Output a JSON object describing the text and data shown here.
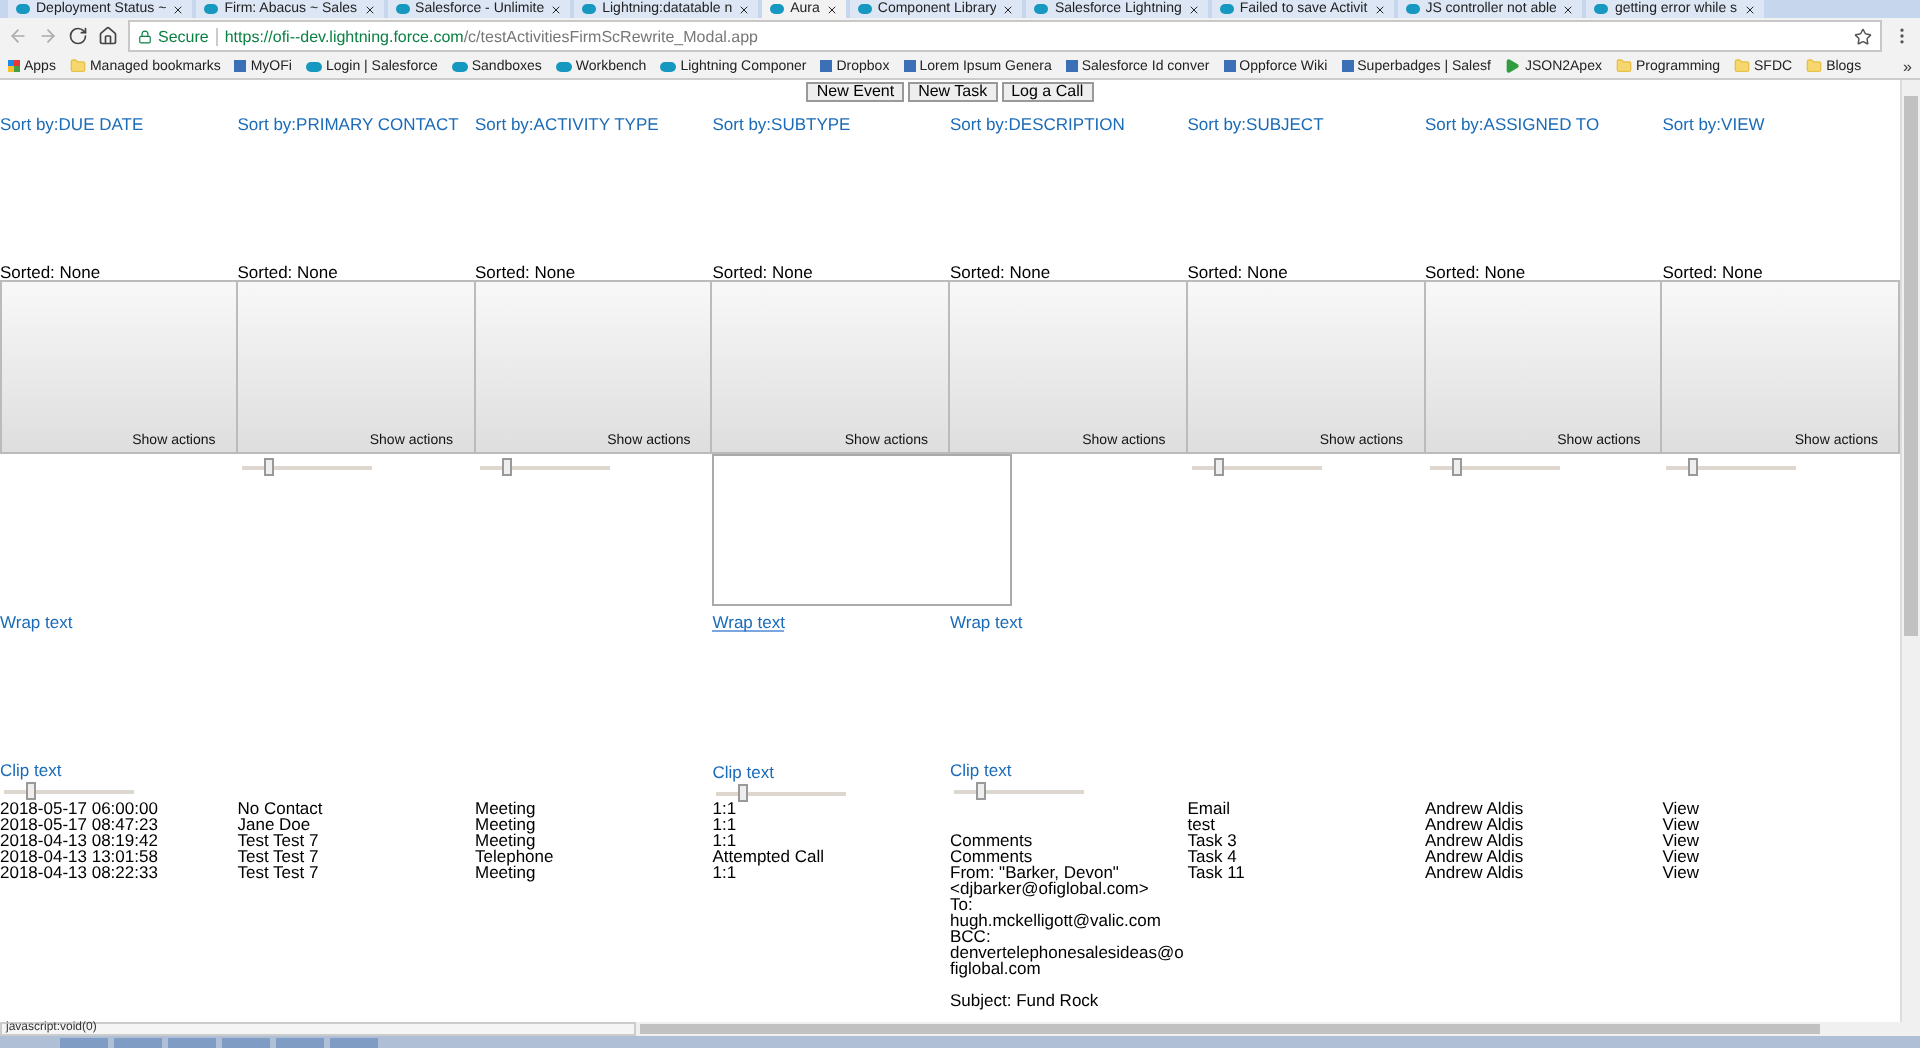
{
  "browser": {
    "tabs": [
      {
        "title": "Deployment Status ~",
        "selected": false
      },
      {
        "title": "Firm: Abacus ~ Sales",
        "selected": false
      },
      {
        "title": "Salesforce - Unlimite",
        "selected": false
      },
      {
        "title": "Lightning:datatable n",
        "selected": false
      },
      {
        "title": "Aura",
        "selected": true
      },
      {
        "title": "Component Library",
        "selected": false
      },
      {
        "title": "Salesforce Lightning",
        "selected": false
      },
      {
        "title": "Failed to save Activit",
        "selected": false
      },
      {
        "title": "JS controller not able",
        "selected": false
      },
      {
        "title": "getting error while s",
        "selected": false
      }
    ],
    "address": {
      "secure_label": "Secure",
      "url_host": "https://ofi--dev.lightning.force.com",
      "url_path": "/c/testActivitiesFirmScRewrite_Modal.app"
    },
    "bookmarks": [
      {
        "label": "Apps",
        "kind": "apps"
      },
      {
        "label": "Managed bookmarks",
        "kind": "folder"
      },
      {
        "label": "MyOFi",
        "kind": "site"
      },
      {
        "label": "Login | Salesforce",
        "kind": "cloud"
      },
      {
        "label": "Sandboxes",
        "kind": "cloud"
      },
      {
        "label": "Workbench",
        "kind": "cloud"
      },
      {
        "label": "Lightning Componer",
        "kind": "cloud"
      },
      {
        "label": "Dropbox",
        "kind": "site"
      },
      {
        "label": "Lorem Ipsum Genera",
        "kind": "site"
      },
      {
        "label": "Salesforce Id conver",
        "kind": "site"
      },
      {
        "label": "Oppforce Wiki",
        "kind": "site"
      },
      {
        "label": "Superbadges | Salesf",
        "kind": "site"
      },
      {
        "label": "JSON2Apex",
        "kind": "play"
      },
      {
        "label": "Programming",
        "kind": "folder"
      },
      {
        "label": "SFDC",
        "kind": "folder"
      },
      {
        "label": "Blogs",
        "kind": "folder"
      }
    ],
    "more_label": "»"
  },
  "page": {
    "buttons": [
      "New Event",
      "New Task",
      "Log a Call"
    ],
    "columns": [
      {
        "sort_link": "Sort by:DUE DATE",
        "sorted": "Sorted: None",
        "actions": "Show actions",
        "kind": "wrap_clip",
        "menu_open": false,
        "wrap": "Wrap text",
        "wrap_focused": false,
        "clip": "Clip text",
        "level": 0.2
      },
      {
        "sort_link": "Sort by:PRIMARY CONTACT",
        "sorted": "Sorted: None",
        "actions": "Show actions",
        "kind": "slider",
        "level": 0.2
      },
      {
        "sort_link": "Sort by:ACTIVITY TYPE",
        "sorted": "Sorted: None",
        "actions": "Show actions",
        "kind": "slider",
        "level": 0.2
      },
      {
        "sort_link": "Sort by:SUBTYPE",
        "sorted": "Sorted: None",
        "actions": "Show actions",
        "kind": "wrap_clip",
        "menu_open": true,
        "wrap": "Wrap text",
        "wrap_focused": true,
        "clip": "Clip text",
        "level": 0.2
      },
      {
        "sort_link": "Sort by:DESCRIPTION",
        "sorted": "Sorted: None",
        "actions": "Show actions",
        "kind": "wrap_clip",
        "menu_open": false,
        "wrap": "Wrap text",
        "wrap_focused": false,
        "clip": "Clip text",
        "level": 0.2
      },
      {
        "sort_link": "Sort by:SUBJECT",
        "sorted": "Sorted: None",
        "actions": "Show actions",
        "kind": "slider",
        "level": 0.2
      },
      {
        "sort_link": "Sort by:ASSIGNED TO",
        "sorted": "Sorted: None",
        "actions": "Show actions",
        "kind": "slider",
        "level": 0.2
      },
      {
        "sort_link": "Sort by:VIEW",
        "sorted": "Sorted: None",
        "actions": "Show actions",
        "kind": "slider",
        "level": 0.2
      }
    ],
    "rows": [
      [
        "2018-05-17 06:00:00",
        "No Contact",
        "Meeting",
        "1:1",
        "",
        "Email",
        "Andrew Aldis",
        "View"
      ],
      [
        "2018-05-17 08:47:23",
        "Jane Doe",
        "Meeting",
        "1:1",
        "",
        "test",
        "Andrew Aldis",
        "View"
      ],
      [
        "2018-04-13 08:19:42",
        "Test Test 7",
        "Meeting",
        "1:1",
        "Comments",
        "Task 3",
        "Andrew Aldis",
        "View"
      ],
      [
        "2018-04-13 13:01:58",
        "Test Test 7",
        "Telephone",
        "Attempted Call",
        "Comments",
        "Task 4",
        "Andrew Aldis",
        "View"
      ],
      [
        "2018-04-13 08:22:33",
        "Test Test 7",
        "Meeting",
        "1:1",
        "From: \"Barker, Devon\"\n<djbarker@ofiglobal.com>\nTo: hugh.mckelligott@valic.com\nBCC:\ndenvertelephonesalesideas@ofiglobal.com\n\nSubject: Fund Rock",
        "Task 11",
        "Andrew Aldis",
        "View"
      ]
    ]
  },
  "status_text": "javascript:void(0)"
}
